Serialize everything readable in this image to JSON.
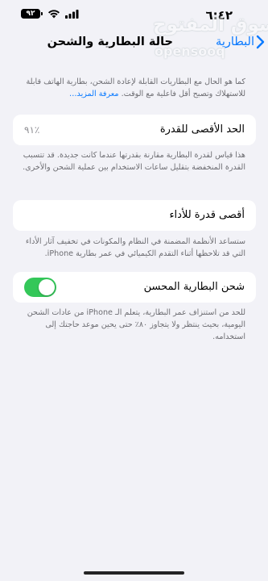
{
  "status_bar": {
    "time": "٦:٤٢",
    "battery_level": "٩٢"
  },
  "nav": {
    "back_label": "البطارية",
    "title": "حالة البطارية والشحن"
  },
  "watermark": {
    "arabic": "السوق المفتوح",
    "english": "opensooq"
  },
  "intro": {
    "text": "كما هو الحال مع البطاريات القابلة لإعادة الشحن، بطارية الهاتف قابلة للاستهلاك وتصبح أقل فاعلية مع الوقت.",
    "link": "معرفة المزيد…"
  },
  "max_capacity": {
    "label": "الحد الأقصى للقدرة",
    "value": "٪٩١",
    "description": "هذا قياس لقدرة البطارية مقارنة بقدرتها عندما كانت جديدة. قد تتسبب القدرة المنخفضة بتقليل ساعات الاستخدام بين عملية الشحن والأخرى."
  },
  "peak_performance": {
    "label": "أقصى قدرة للأداء",
    "description": "ستساعد الأنظمة المضمنة في النظام والمكونات في تخفيف آثار الأداء التي قد تلاحظها أثناء التقدم الكيميائي في عمر بطارية iPhone."
  },
  "optimized_charging": {
    "label": "شحن البطارية المحسن",
    "enabled": true,
    "description": "للحد من استنزاف عمر البطارية، يتعلم الـ iPhone من عادات الشحن اليومية، بحيث ينتظر ولا يتجاوز ٨٠٪ حتى يحين موعد حاجتك إلى استخدامه."
  },
  "colors": {
    "accent": "#0a7aff",
    "toggle_on": "#34c759",
    "background": "#f2f2f7",
    "secondary_text": "#6d6d72"
  }
}
